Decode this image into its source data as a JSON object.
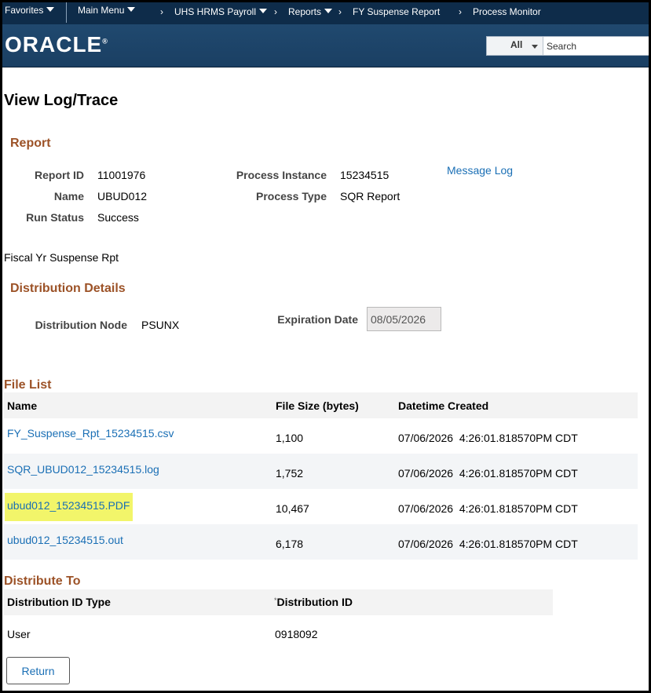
{
  "nav": {
    "favorites": "Favorites",
    "main_menu": "Main Menu",
    "crumbs": [
      "UHS HRMS Payroll",
      "Reports",
      "FY Suspense Report",
      "Process Monitor"
    ]
  },
  "banner": {
    "logo": "ORACLE",
    "search_scope": "All",
    "search_placeholder": "Search"
  },
  "page": {
    "title": "View Log/Trace",
    "report_section": "Report",
    "report_id_label": "Report ID",
    "report_id": "11001976",
    "name_label": "Name",
    "name": "UBUD012",
    "run_status_label": "Run Status",
    "run_status": "Success",
    "process_instance_label": "Process Instance",
    "process_instance": "15234515",
    "process_type_label": "Process Type",
    "process_type": "SQR Report",
    "message_log": "Message Log",
    "description": "Fiscal Yr Suspense Rpt",
    "distribution_section": "Distribution Details",
    "distribution_node_label": "Distribution Node",
    "distribution_node": "PSUNX",
    "expiration_date_label": "Expiration Date",
    "expiration_date": "08/05/2026"
  },
  "file_list": {
    "title": "File List",
    "headers": [
      "Name",
      "File Size (bytes)",
      "Datetime Created"
    ],
    "rows": [
      {
        "name": "FY_Suspense_Rpt_15234515.csv",
        "size": "1,100",
        "created": "07/06/2026  4:26:01.818570PM CDT"
      },
      {
        "name": "SQR_UBUD012_15234515.log",
        "size": "1,752",
        "created": "07/06/2026  4:26:01.818570PM CDT"
      },
      {
        "name": "ubud012_15234515.PDF",
        "size": "10,467",
        "created": "07/06/2026  4:26:01.818570PM CDT"
      },
      {
        "name": "ubud012_15234515.out",
        "size": "6,178",
        "created": "07/06/2026  4:26:01.818570PM CDT"
      }
    ]
  },
  "distribute_to": {
    "title": "Distribute To",
    "headers": [
      "Distribution ID Type",
      "Distribution ID"
    ],
    "required_mark": "*",
    "rows": [
      {
        "type": "User",
        "id": "0918092"
      }
    ]
  },
  "return_label": "Return"
}
